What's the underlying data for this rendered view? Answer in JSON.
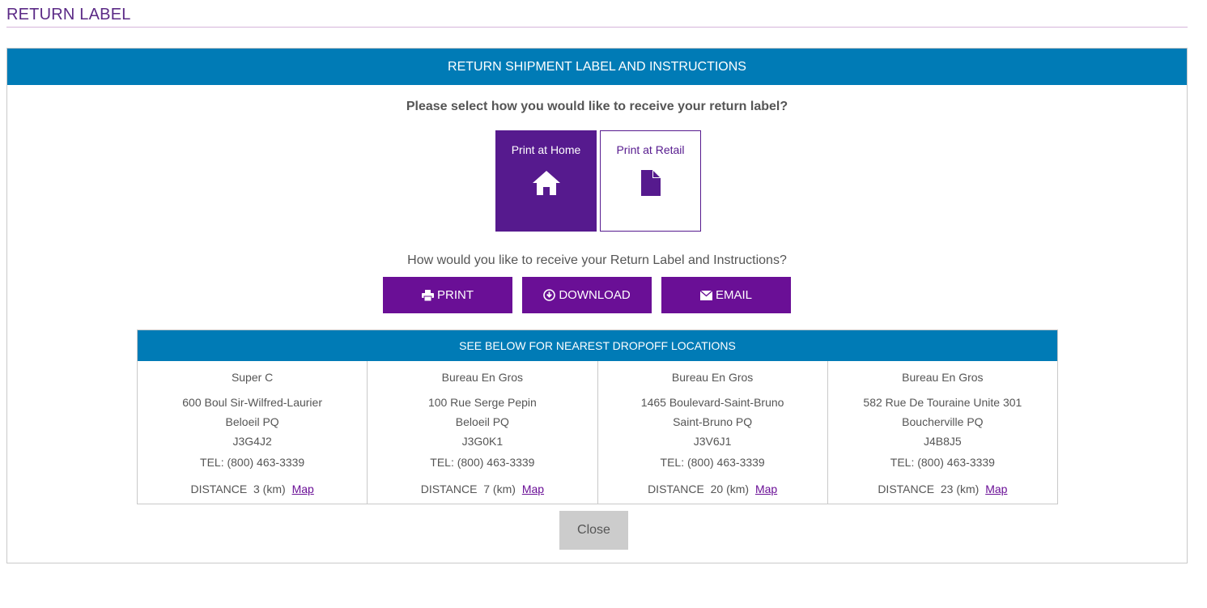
{
  "page": {
    "title": "RETURN LABEL"
  },
  "panel": {
    "header": "RETURN SHIPMENT LABEL AND INSTRUCTIONS",
    "question": "Please select how you would like to receive your return label?",
    "options": [
      {
        "label": "Print at Home",
        "icon": "home-icon",
        "selected": true
      },
      {
        "label": "Print at Retail",
        "icon": "document-icon",
        "selected": false
      }
    ],
    "question2": "How would you like to receive your Return Label and Instructions?",
    "actions": [
      {
        "label": "PRINT",
        "icon": "printer-icon"
      },
      {
        "label": "DOWNLOAD",
        "icon": "download-icon"
      },
      {
        "label": "EMAIL",
        "icon": "envelope-icon"
      }
    ]
  },
  "locations": {
    "header": "SEE BELOW FOR NEAREST DROPOFF LOCATIONS",
    "distance_label": "DISTANCE",
    "distance_unit": "(km)",
    "map_label": "Map",
    "items": [
      {
        "name": "Super C",
        "address": "600 Boul Sir-Wilfred-Laurier",
        "city": "Beloeil PQ",
        "postal": "J3G4J2",
        "tel": "TEL: (800) 463-3339",
        "distance": "3"
      },
      {
        "name": "Bureau En Gros",
        "address": "100 Rue Serge Pepin",
        "city": "Beloeil PQ",
        "postal": "J3G0K1",
        "tel": "TEL: (800) 463-3339",
        "distance": "7"
      },
      {
        "name": "Bureau En Gros",
        "address": "1465 Boulevard-Saint-Bruno",
        "city": "Saint-Bruno PQ",
        "postal": "J3V6J1",
        "tel": "TEL: (800) 463-3339",
        "distance": "20"
      },
      {
        "name": "Bureau En Gros",
        "address": "582 Rue De Touraine Unite 301",
        "city": "Boucherville PQ",
        "postal": "J4B8J5",
        "tel": "TEL: (800) 463-3339",
        "distance": "23"
      }
    ]
  },
  "close_label": "Close",
  "colors": {
    "header_blue": "#007bb6",
    "purple": "#561a8e",
    "button_purple": "#6a0f96",
    "close_gray": "#cccccc"
  }
}
